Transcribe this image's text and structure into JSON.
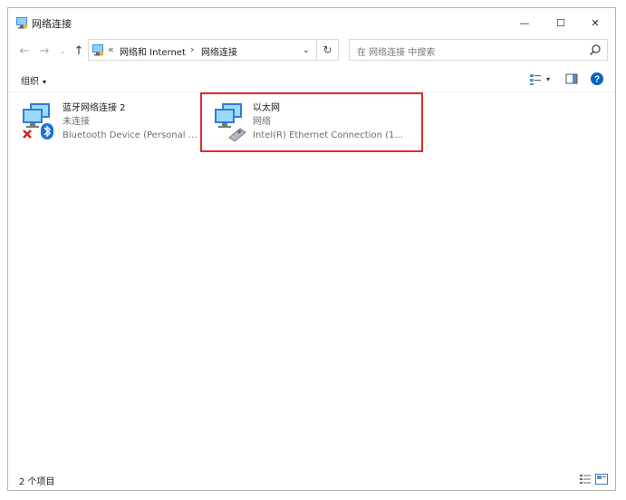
{
  "window": {
    "title": "网络连接",
    "controls": {
      "minimize": "—",
      "maximize": "☐",
      "close": "✕"
    }
  },
  "navigation": {
    "back": "←",
    "forward": "→",
    "recent": "⌄",
    "up": "↑",
    "address": {
      "overflow": "«",
      "crumbs": [
        "网络和 Internet",
        "网络连接"
      ],
      "separator": "›",
      "dropdown": "⌄"
    },
    "refresh": "↻",
    "search": {
      "placeholder": "在 网络连接 中搜索"
    }
  },
  "commandbar": {
    "organize_label": "组织",
    "organize_caret": "▾",
    "view_caret": "▾",
    "help_label": "?"
  },
  "items": [
    {
      "name": "蓝牙网络连接 2",
      "status": "未连接",
      "device": "Bluetooth Device (Personal Area Network)",
      "device_display": "Bluetooth Device (Personal Ar...",
      "icon": "bluetooth-network-disconnected-icon"
    },
    {
      "name": "以太网",
      "status": "网络",
      "device": "Intel(R) Ethernet Connection (1...",
      "device_display": "Intel(R) Ethernet Connection (1...",
      "icon": "ethernet-network-icon",
      "highlighted": true
    }
  ],
  "statusbar": {
    "count": "2 个项目"
  },
  "colors": {
    "highlight": "#e32a2a",
    "accent": "#0067c0",
    "bluetooth": "#1a75d2",
    "error": "#d22020"
  }
}
